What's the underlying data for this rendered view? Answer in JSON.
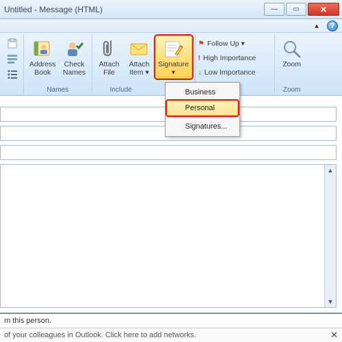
{
  "window": {
    "title": "Untitled - Message (HTML)"
  },
  "subbar": {
    "caret": "▴"
  },
  "ribbon": {
    "names_group": {
      "label": "Names",
      "address_book": "Address\nBook",
      "check_names": "Check\nNames"
    },
    "include_group": {
      "label": "Include",
      "attach_file": "Attach\nFile",
      "attach_item": "Attach\nItem ▾",
      "signature": "Signature\n▾",
      "menu": {
        "business": "Business",
        "personal": "Personal",
        "signatures": "Signatures..."
      }
    },
    "tags_group": {
      "followup": "Follow Up ▾",
      "high": "High Importance",
      "low": "Low Importance"
    },
    "zoom_group": {
      "label": "Zoom",
      "zoom": "Zoom"
    }
  },
  "info1": "m this person.",
  "info2": "of your colleagues in Outlook. Click here to add networks."
}
